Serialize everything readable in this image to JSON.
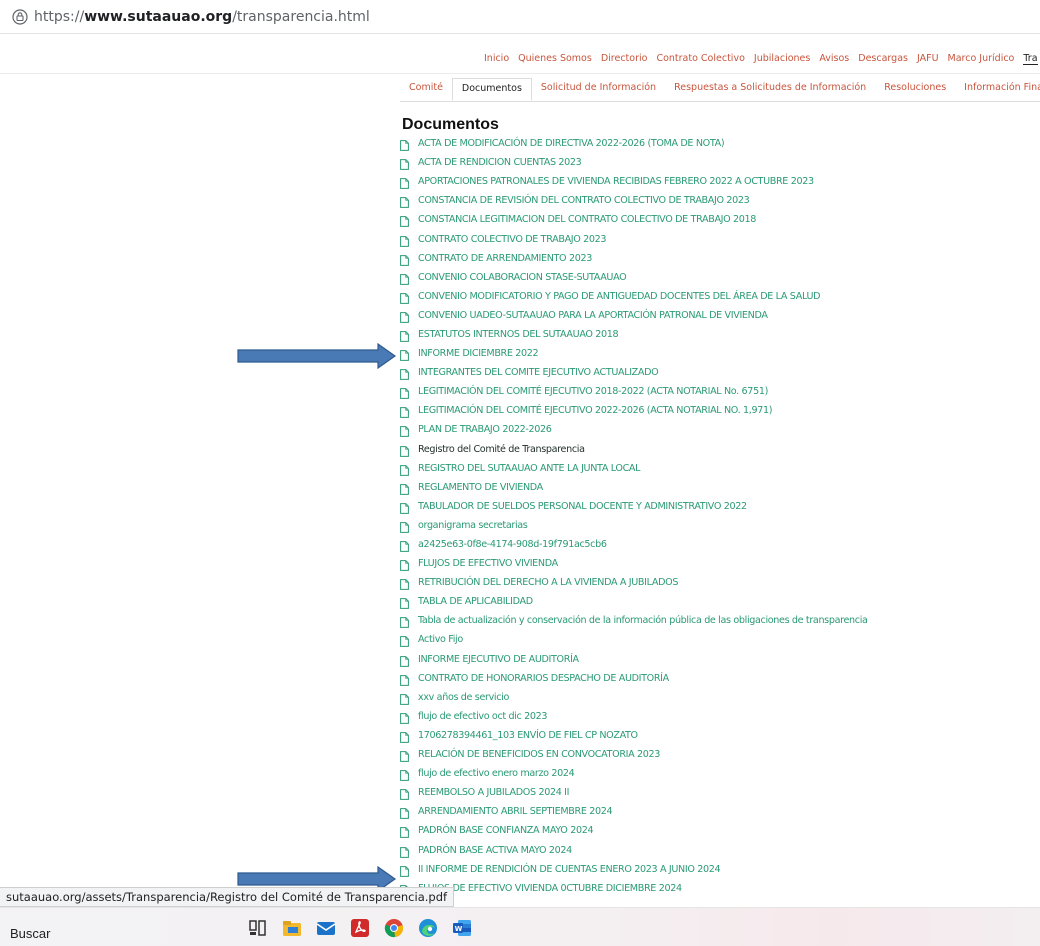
{
  "browser": {
    "url_scheme": "https://",
    "url_host": "www.sutaauao.org",
    "url_path": "/transparencia.html"
  },
  "topnav": {
    "items": [
      "Inicio",
      "Quienes Somos",
      "Directorio",
      "Contrato Colectivo",
      "Jubilaciones",
      "Avisos",
      "Descargas",
      "JAFU",
      "Marco Jurídico",
      "Tra"
    ]
  },
  "subtabs": {
    "items": [
      "Comité",
      "Documentos",
      "Solicitud de Información",
      "Respuestas a Solicitudes de Información",
      "Resoluciones",
      "Información Financiera"
    ]
  },
  "section": {
    "title": "Documentos"
  },
  "documents": [
    "ACTA DE MODIFICACIÓN DE DIRECTIVA 2022-2026 (TOMA DE NOTA)",
    "ACTA DE RENDICION CUENTAS 2023",
    "APORTACIONES PATRONALES DE VIVIENDA RECIBIDAS FEBRERO 2022 A OCTUBRE 2023",
    "CONSTANCIA DE REVISIÓN DEL CONTRATO COLECTIVO DE TRABAJO 2023",
    "CONSTANCIA LEGITIMACION DEL CONTRATO COLECTIVO DE TRABAJO 2018",
    "CONTRATO COLECTIVO DE TRABAJO 2023",
    "CONTRATO DE ARRENDAMIENTO 2023",
    "CONVENIO COLABORACION STASE-SUTAAUAO",
    "CONVENIO MODIFICATORIO Y PAGO DE ANTIGUEDAD DOCENTES DEL ÁREA DE LA SALUD",
    "CONVENIO UADEO-SUTAAUAO PARA LA APORTACIÓN PATRONAL DE VIVIENDA",
    "ESTATUTOS INTERNOS DEL SUTAAUAO 2018",
    "INFORME DICIEMBRE 2022",
    "INTEGRANTES DEL COMITE EJECUTIVO ACTUALIZADO",
    "LEGITIMACIÓN DEL COMITÉ EJECUTIVO 2018-2022 (ACTA NOTARIAL No. 6751)",
    "LEGITIMACIÓN DEL COMITÉ EJECUTIVO 2022-2026 (ACTA NOTARIAL NO. 1,971)",
    "PLAN DE TRABAJO 2022-2026",
    "Registro del Comité de Transparencia",
    "REGISTRO DEL SUTAAUAO ANTE LA JUNTA LOCAL",
    "REGLAMENTO DE VIVIENDA",
    "TABULADOR DE SUELDOS PERSONAL DOCENTE Y ADMINISTRATIVO 2022",
    "organigrama secretarias",
    "a2425e63-0f8e-4174-908d-19f791ac5cb6",
    "FLUJOS DE EFECTIVO VIVIENDA",
    "RETRIBUCIÓN DEL DERECHO A LA VIVIENDA A JUBILADOS",
    "TABLA DE APLICABILIDAD",
    "Tabla de actualización y conservación de la información pública de las obligaciones de transparencia",
    "Activo Fijo",
    "INFORME EJECUTIVO DE AUDITORÍA",
    "CONTRATO DE HONORARIOS DESPACHO DE AUDITORÍA",
    "xxv años de servicio",
    "flujo de efectivo oct dic 2023",
    "1706278394461_103 ENVÍO DE FIEL CP NOZATO",
    "RELACIÓN DE BENEFICIDOS EN CONVOCATORIA 2023",
    "flujo de efectivo enero marzo 2024",
    "REEMBOLSO A JUBILADOS 2024 II",
    "ARRENDAMIENTO ABRIL SEPTIEMBRE 2024",
    "PADRÓN BASE CONFIANZA MAYO 2024",
    "PADRÓN BASE ACTIVA MAYO 2024",
    "II INFORME DE RENDICIÓN DE CUENTAS ENERO 2023 A JUNIO 2024",
    "FLUJOS DE EFECTIVO VIVIENDA 0CTUBRE DICIEMBRE 2024"
  ],
  "statusbar": {
    "text": "sutaauao.org/assets/Transparencia/Registro del Comité de Transparencia.pdf"
  },
  "taskbar": {
    "search_label": "Buscar",
    "apps": [
      "task-view-icon",
      "file-explorer-icon",
      "mail-icon",
      "acrobat-icon",
      "chrome-icon",
      "edge-icon",
      "word-icon"
    ]
  },
  "colors": {
    "link": "#2a9a74",
    "nav": "#c8553d",
    "arrow": "#4a7ab5"
  }
}
